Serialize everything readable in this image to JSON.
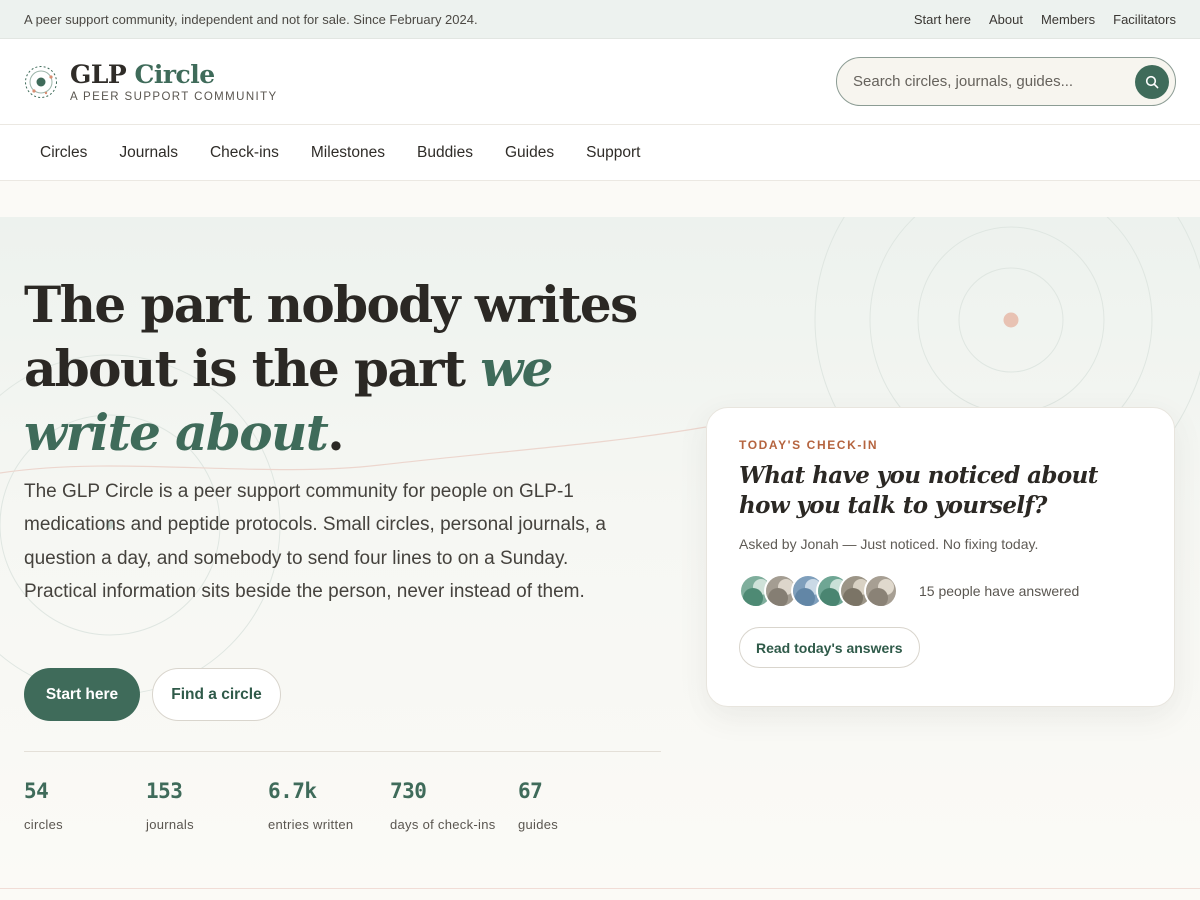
{
  "topstrip": {
    "tagline": "A peer support community, independent and not for sale. Since February 2024.",
    "links": [
      "Start here",
      "About",
      "Members",
      "Facilitators"
    ]
  },
  "header": {
    "brand_name_part1": "GLP",
    "brand_name_part2": "Circle",
    "brand_tagline": "A PEER SUPPORT COMMUNITY",
    "search_placeholder": "Search circles, journals, guides...",
    "logo_icon": "concentric-circle-logo-icon",
    "search_icon": "search-icon"
  },
  "nav": {
    "items": [
      "Circles",
      "Journals",
      "Check-ins",
      "Milestones",
      "Buddies",
      "Guides",
      "Support"
    ]
  },
  "hero": {
    "headline_part1": "The part nobody writes about is the part",
    "headline_em": "we write about",
    "headline_end": ".",
    "lede": "The GLP Circle is a peer support community for people on GLP-1 medications and peptide protocols. Small circles, personal journals, a question a day, and somebody to send four lines to on a Sunday. Practical information sits beside the person, never instead of them.",
    "primary_cta": "Start here",
    "secondary_cta": "Find a circle",
    "stats": [
      {
        "value": "54",
        "label": "circles"
      },
      {
        "value": "153",
        "label": "journals"
      },
      {
        "value": "6.7k",
        "label": "entries written"
      },
      {
        "value": "730",
        "label": "days of check-ins"
      },
      {
        "value": "67",
        "label": "guides"
      }
    ]
  },
  "checkin": {
    "kicker": "TODAY'S CHECK-IN",
    "question": "What have you noticed about how you talk to yourself?",
    "asked_by": "Asked by Jonah — Just noticed. No fixing today.",
    "answered_count_text": "15 people have answered",
    "cta": "Read today's answers"
  },
  "colors": {
    "accent": "#3f6b5a",
    "kicker": "#b5643f",
    "background": "#fbfaf6",
    "topstrip": "#edf2ef"
  }
}
